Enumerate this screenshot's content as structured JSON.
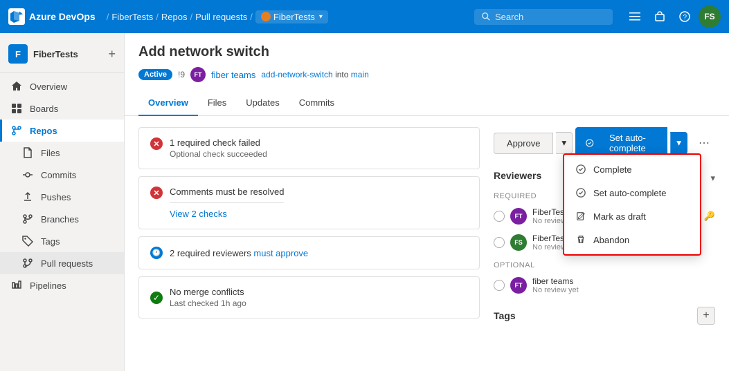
{
  "topnav": {
    "logo_letter": "A",
    "app_name": "Azure DevOps",
    "breadcrumbs": [
      "FiberTests",
      "Repos",
      "Pull requests",
      "FiberTests"
    ],
    "search_placeholder": "Search",
    "more_icon": "⋯",
    "basket_icon": "🛍",
    "help_icon": "?",
    "user_initials": "FS"
  },
  "sidebar": {
    "project_letter": "F",
    "project_name": "FiberTests",
    "items": [
      {
        "id": "overview",
        "label": "Overview",
        "icon": "home"
      },
      {
        "id": "boards",
        "label": "Boards",
        "icon": "boards"
      },
      {
        "id": "repos",
        "label": "Repos",
        "icon": "repos",
        "active": true
      },
      {
        "id": "files",
        "label": "Files",
        "icon": "files"
      },
      {
        "id": "commits",
        "label": "Commits",
        "icon": "commits"
      },
      {
        "id": "pushes",
        "label": "Pushes",
        "icon": "pushes"
      },
      {
        "id": "branches",
        "label": "Branches",
        "icon": "branches"
      },
      {
        "id": "tags",
        "label": "Tags",
        "icon": "tags"
      },
      {
        "id": "pull-requests",
        "label": "Pull requests",
        "icon": "pr",
        "active_item": true
      },
      {
        "id": "pipelines",
        "label": "Pipelines",
        "icon": "pipelines"
      }
    ]
  },
  "pr": {
    "title": "Add network switch",
    "status": "Active",
    "id": "!9",
    "author_initials": "FT",
    "author_name": "fiber teams",
    "branch_from": "add-network-switch",
    "branch_into": "into",
    "branch_to": "main",
    "tabs": [
      {
        "id": "overview",
        "label": "Overview",
        "active": true
      },
      {
        "id": "files",
        "label": "Files"
      },
      {
        "id": "updates",
        "label": "Updates"
      },
      {
        "id": "commits",
        "label": "Commits"
      }
    ],
    "checks": [
      {
        "type": "error",
        "title": "1 required check failed",
        "subtitle": "Optional check succeeded"
      },
      {
        "type": "error",
        "title": "Comments must be resolved"
      }
    ],
    "view_checks_link": "View 2 checks",
    "reviewers_check": {
      "type": "info",
      "title": "2 required reviewers must approve"
    },
    "merge_check": {
      "type": "success",
      "title": "No merge conflicts",
      "subtitle": "Last checked 1h ago"
    },
    "approve_label": "Approve",
    "auto_complete_label": "Set auto-complete",
    "dropdown_items": [
      {
        "id": "complete",
        "label": "Complete",
        "icon": "check-circle"
      },
      {
        "id": "set-auto-complete",
        "label": "Set auto-complete",
        "icon": "auto-complete"
      },
      {
        "id": "mark-as-draft",
        "label": "Mark as draft",
        "icon": "draft"
      },
      {
        "id": "abandon",
        "label": "Abandon",
        "icon": "trash"
      }
    ]
  },
  "reviewers": {
    "title": "Reviewers",
    "required_label": "Required",
    "optional_label": "Optional",
    "required_reviewers": [
      {
        "name": "FiberTests Team",
        "initials": "FT",
        "bg": "#7b1fa2",
        "status": "No review yet",
        "has_icon": true
      },
      {
        "name": "FiberTests Build Service (fiber-te...",
        "initials": "FS",
        "bg": "#2e7d32",
        "status": "No review yet",
        "has_icon": false
      }
    ],
    "optional_reviewers": [
      {
        "name": "fiber teams",
        "initials": "FT",
        "bg": "#7b1fa2",
        "status": "No review yet",
        "has_icon": false
      }
    ]
  },
  "tags": {
    "title": "Tags",
    "add_label": "+"
  }
}
